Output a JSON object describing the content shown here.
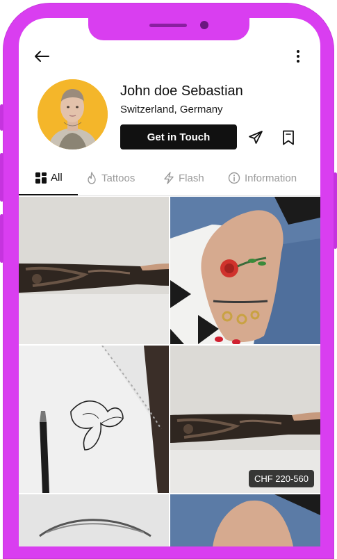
{
  "profile": {
    "name": "John doe Sebastian",
    "location": "Switzerland, Germany",
    "cta_label": "Get in Touch",
    "icons": {
      "back": "arrow-left-icon",
      "more": "more-vertical-icon",
      "send": "send-icon",
      "bookmark": "bookmark-icon"
    }
  },
  "tabs": [
    {
      "label": "All",
      "icon": "grid-icon",
      "active": true
    },
    {
      "label": "Tattoos",
      "icon": "flame-icon",
      "active": false
    },
    {
      "label": "Flash",
      "icon": "lightning-icon",
      "active": false
    },
    {
      "label": "Information",
      "icon": "info-icon",
      "active": false
    }
  ],
  "gallery": [
    {
      "subject": "sleeve tattoo on forearm"
    },
    {
      "subject": "rose tattoo on hand with rings"
    },
    {
      "subject": "flower sketch on notepad with pen"
    },
    {
      "subject": "sleeve tattoo on forearm",
      "price": "CHF 220-560"
    },
    {
      "subject": "eye pencil drawing"
    },
    {
      "subject": "hand tattoo"
    }
  ],
  "colors": {
    "phone_frame": "#d93ef0",
    "button_bg": "#111111",
    "avatar_bg": "#f4b62a",
    "inactive_tab": "#9a9a9a"
  }
}
